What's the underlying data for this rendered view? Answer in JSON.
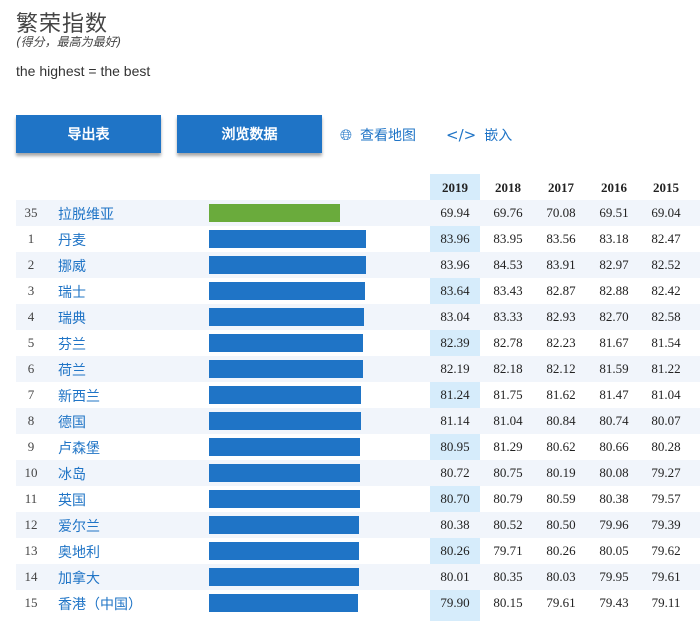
{
  "header": {
    "title": "繁荣指数",
    "subtitle": "(得分，最高为最好)",
    "description": "the highest = the best"
  },
  "toolbar": {
    "export_label": "导出表",
    "browse_label": "浏览数据",
    "map_label": "查看地图",
    "map_icon": "globe-icon",
    "embed_label": "嵌入",
    "embed_icon": "code-icon"
  },
  "colors": {
    "highlight_bar": "#6aab3c",
    "bar": "#1f74c6",
    "year_highlight": "#d6ecfb"
  },
  "table": {
    "years": [
      "2019",
      "2018",
      "2017",
      "2016",
      "2015"
    ],
    "bar_max": 83.96,
    "rows": [
      {
        "rank": "35",
        "country": "拉脱维亚",
        "values": [
          "69.94",
          "69.76",
          "70.08",
          "69.51",
          "69.04"
        ],
        "highlight": true
      },
      {
        "rank": "1",
        "country": "丹麦",
        "values": [
          "83.96",
          "83.95",
          "83.56",
          "83.18",
          "82.47"
        ]
      },
      {
        "rank": "2",
        "country": "挪威",
        "values": [
          "83.96",
          "84.53",
          "83.91",
          "82.97",
          "82.52"
        ]
      },
      {
        "rank": "3",
        "country": "瑞士",
        "values": [
          "83.64",
          "83.43",
          "82.87",
          "82.88",
          "82.42"
        ]
      },
      {
        "rank": "4",
        "country": "瑞典",
        "values": [
          "83.04",
          "83.33",
          "82.93",
          "82.70",
          "82.58"
        ]
      },
      {
        "rank": "5",
        "country": "芬兰",
        "values": [
          "82.39",
          "82.78",
          "82.23",
          "81.67",
          "81.54"
        ]
      },
      {
        "rank": "6",
        "country": "荷兰",
        "values": [
          "82.19",
          "82.18",
          "82.12",
          "81.59",
          "81.22"
        ]
      },
      {
        "rank": "7",
        "country": "新西兰",
        "values": [
          "81.24",
          "81.75",
          "81.62",
          "81.47",
          "81.04"
        ]
      },
      {
        "rank": "8",
        "country": "德国",
        "values": [
          "81.14",
          "81.04",
          "80.84",
          "80.74",
          "80.07"
        ]
      },
      {
        "rank": "9",
        "country": "卢森堡",
        "values": [
          "80.95",
          "81.29",
          "80.62",
          "80.66",
          "80.28"
        ]
      },
      {
        "rank": "10",
        "country": "冰岛",
        "values": [
          "80.72",
          "80.75",
          "80.19",
          "80.08",
          "79.27"
        ]
      },
      {
        "rank": "11",
        "country": "英国",
        "values": [
          "80.70",
          "80.79",
          "80.59",
          "80.38",
          "79.57"
        ]
      },
      {
        "rank": "12",
        "country": "爱尔兰",
        "values": [
          "80.38",
          "80.52",
          "80.50",
          "79.96",
          "79.39"
        ]
      },
      {
        "rank": "13",
        "country": "奥地利",
        "values": [
          "80.26",
          "79.71",
          "80.26",
          "80.05",
          "79.62"
        ]
      },
      {
        "rank": "14",
        "country": "加拿大",
        "values": [
          "80.01",
          "80.35",
          "80.03",
          "79.95",
          "79.61"
        ]
      },
      {
        "rank": "15",
        "country": "香港（中国）",
        "values": [
          "79.90",
          "80.15",
          "79.61",
          "79.43",
          "79.11"
        ]
      }
    ]
  }
}
